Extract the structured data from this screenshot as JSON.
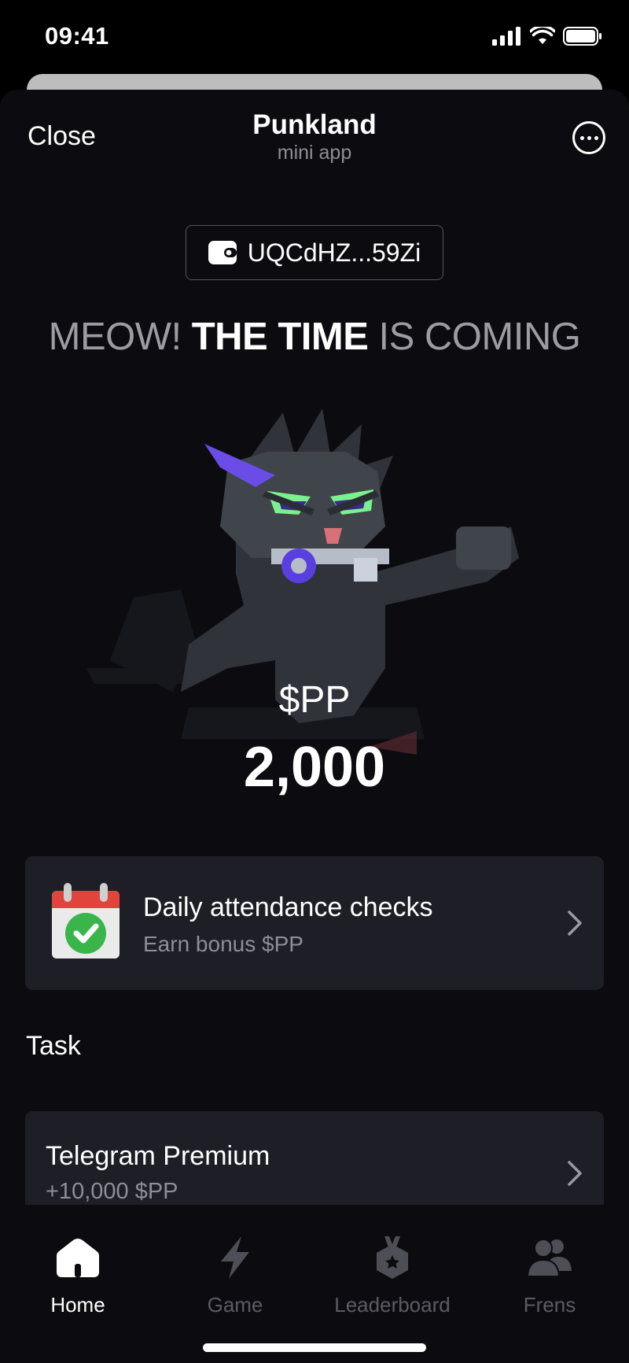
{
  "status_bar": {
    "time": "09:41"
  },
  "header": {
    "close_label": "Close",
    "title": "Punkland",
    "subtitle": "mini app"
  },
  "wallet": {
    "address": "UQCdHZ...59Zi"
  },
  "headline": {
    "part1": "MEOW! ",
    "part2": "THE TIME",
    "part3": " IS COMING"
  },
  "balance": {
    "token": "$PP",
    "amount": "2,000"
  },
  "daily": {
    "title": "Daily attendance checks",
    "subtitle": "Earn bonus $PP"
  },
  "tasks": {
    "heading": "Task",
    "items": [
      {
        "title": "Telegram Premium",
        "reward": "+10,000 $PP"
      }
    ]
  },
  "tabs": [
    {
      "label": "Home",
      "icon": "home-icon",
      "active": true
    },
    {
      "label": "Game",
      "icon": "lightning-icon",
      "active": false
    },
    {
      "label": "Leaderboard",
      "icon": "medal-icon",
      "active": false
    },
    {
      "label": "Frens",
      "icon": "friends-icon",
      "active": false
    }
  ],
  "colors": {
    "background": "#0c0c10",
    "card": "#1e1e26",
    "muted": "#8e8e95",
    "accent_purple": "#6b4ce6",
    "accent_green": "#7cf08c"
  }
}
